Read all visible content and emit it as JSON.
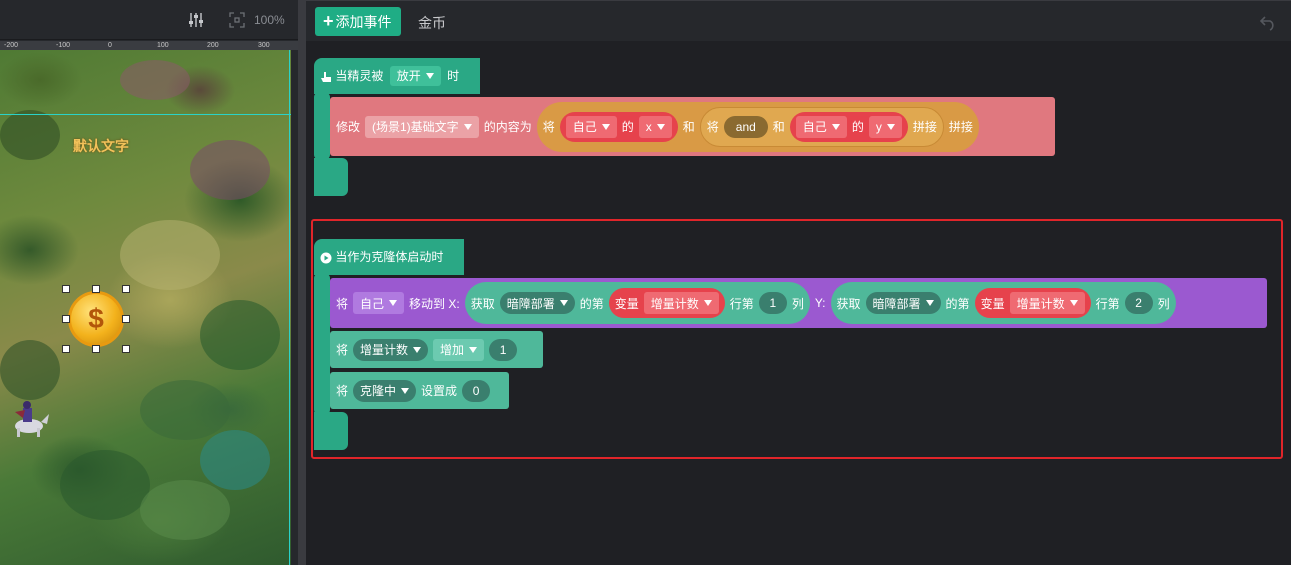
{
  "stage": {
    "zoom": "100%",
    "ruler_labels": [
      "-200",
      "-100",
      "0",
      "100",
      "200",
      "300"
    ],
    "default_text": "默认文字",
    "coin_symbol": "$"
  },
  "toolbar": {
    "add_event_label": "添加事件",
    "tab_label": "金币"
  },
  "event1": {
    "hat_prefix": "当精灵被",
    "hat_dropdown": "放开",
    "hat_suffix": "时",
    "modify_label": "修改",
    "target_dropdown": "(场景1)基础文字",
    "content_label": "的内容为",
    "jiang1": "将",
    "self1": "自己",
    "de1": "的",
    "attr1": "x",
    "he1": "和",
    "jiang2": "将",
    "and_label": "and",
    "he2": "和",
    "self2": "自己",
    "de2": "的",
    "attr2": "y",
    "concat1": "拼接",
    "concat2": "拼接"
  },
  "event2": {
    "hat_label": "当作为克隆体启动时",
    "row1": {
      "jiang": "将",
      "self": "自己",
      "move_label": "移动到 X:",
      "get1": "获取",
      "list1": "暗障部署",
      "di1": "的第",
      "var1_label": "变量",
      "var1": "增量计数",
      "row_label1": "行第",
      "col1": "1",
      "lie1": "列",
      "y_label": "Y:",
      "get2": "获取",
      "list2": "暗障部署",
      "di2": "的第",
      "var2_label": "变量",
      "var2": "增量计数",
      "row_label2": "行第",
      "col2": "2",
      "lie2": "列"
    },
    "row2": {
      "jiang": "将",
      "var": "增量计数",
      "op": "增加",
      "value": "1"
    },
    "row3": {
      "jiang": "将",
      "var": "克隆中",
      "set_label": "设置成",
      "value": "0"
    }
  },
  "colors": {
    "event_green": "#2aa885",
    "looks_pink": "#e0787f",
    "operator_orange": "#d99a45",
    "sensing_red": "#e6424c",
    "motion_purple": "#9b59d0",
    "data_teal": "#4fb89a",
    "selection_red": "#e0252a",
    "guide_cyan": "#2ad3c8"
  }
}
